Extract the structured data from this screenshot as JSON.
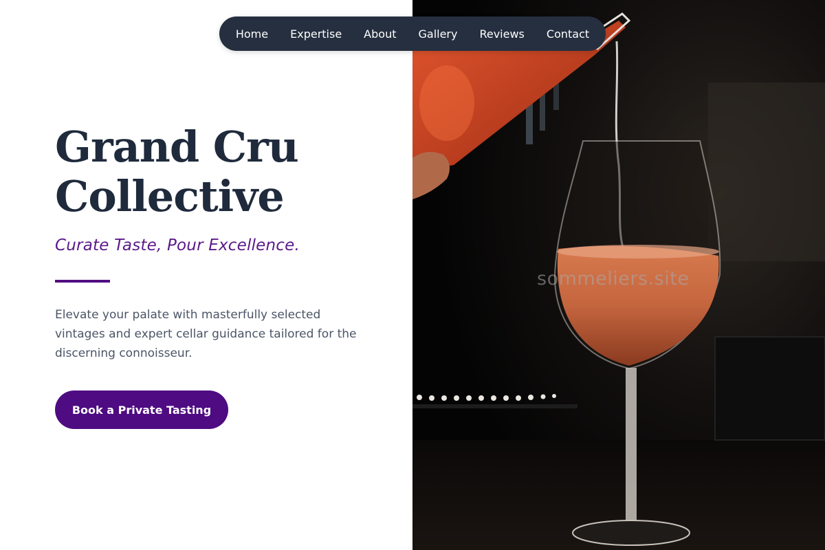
{
  "nav": {
    "items": [
      {
        "label": "Home"
      },
      {
        "label": "Expertise"
      },
      {
        "label": "About"
      },
      {
        "label": "Gallery"
      },
      {
        "label": "Reviews"
      },
      {
        "label": "Contact"
      }
    ]
  },
  "hero": {
    "title_line1": "Grand Cru",
    "title_line2": "Collective",
    "tagline": "Curate Taste, Pour Excellence.",
    "description": "Elevate your palate with masterfully selected vintages and expert cellar guidance tailored for the discerning connoisseur.",
    "cta_label": "Book a Private Tasting"
  },
  "image": {
    "watermark": "sommeliers.site"
  },
  "colors": {
    "nav_bg": "#252f3f",
    "title": "#1f2a3c",
    "accent_purple": "#4e0b82",
    "body_text": "#4b5567"
  }
}
